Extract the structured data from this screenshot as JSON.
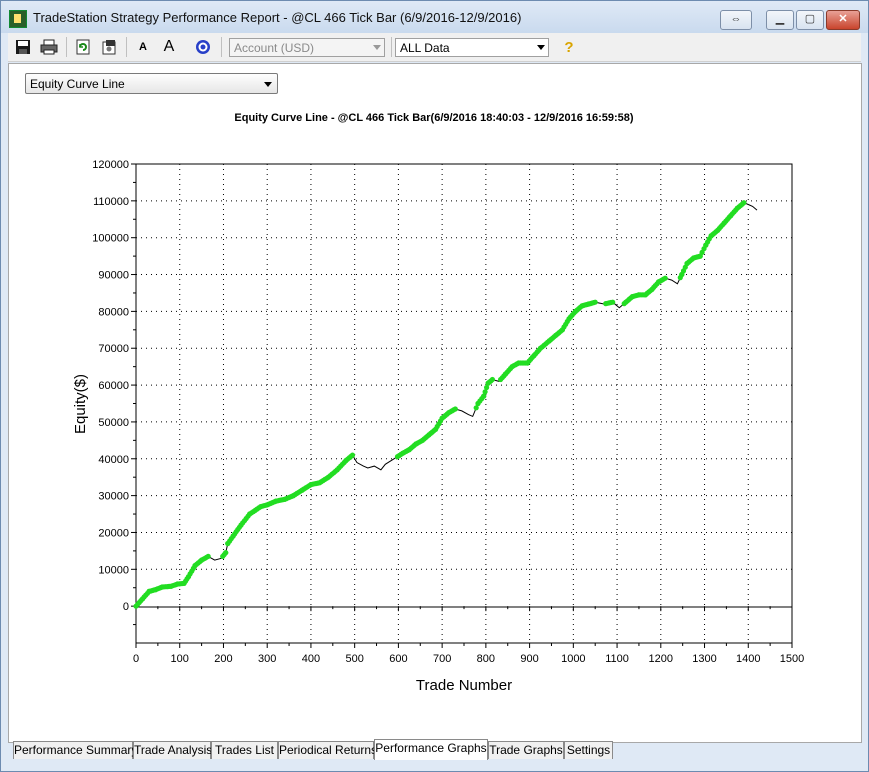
{
  "window": {
    "title": "TradeStation Strategy Performance Report - @CL 466 Tick Bar (6/9/2016-12/9/2016)",
    "controls": {
      "restore_arrows": "⇔",
      "minimize": "▁",
      "maximize": "▢",
      "close": "✕"
    }
  },
  "toolbar": {
    "icons": [
      "save-icon",
      "print-icon",
      "refresh-icon",
      "settings-icon",
      "font-decrease-icon",
      "font-increase-icon",
      "target-icon",
      "help-icon"
    ],
    "account_combo": "Account (USD)",
    "data_combo": "ALL Data",
    "font_small": "A",
    "font_big": "A",
    "help": "?"
  },
  "view_select": "Equity Curve Line",
  "chart": {
    "title": "Equity Curve Line - @CL 466 Tick Bar(6/9/2016 18:40:03 - 12/9/2016 16:59:58)",
    "xlabel": "Trade Number",
    "ylabel": "Equity($)"
  },
  "chart_data": {
    "type": "line",
    "title": "Equity Curve Line - @CL 466 Tick Bar(6/9/2016 18:40:03 - 12/9/2016 16:59:58)",
    "xlabel": "Trade Number",
    "ylabel": "Equity($)",
    "xlim": [
      0,
      1500
    ],
    "ylim": [
      -10000,
      120000
    ],
    "x_ticks": [
      "0",
      "100",
      "200",
      "300",
      "400",
      "500",
      "600",
      "700",
      "800",
      "900",
      "1000",
      "1100",
      "1200",
      "1300",
      "1400",
      "1500"
    ],
    "y_ticks": [
      "0",
      "10000",
      "20000",
      "30000",
      "40000",
      "50000",
      "60000",
      "70000",
      "80000",
      "90000",
      "100000",
      "110000",
      "120000"
    ],
    "grid": true,
    "line_color": "#000000",
    "highlight_color": "#22dd22",
    "series": [
      {
        "points": [
          [
            0,
            0
          ],
          [
            15,
            2000
          ],
          [
            30,
            4000
          ],
          [
            45,
            4500
          ],
          [
            60,
            5200
          ],
          [
            80,
            5400
          ],
          [
            95,
            6000
          ],
          [
            110,
            6200
          ],
          [
            120,
            8000
          ],
          [
            135,
            11000
          ],
          [
            150,
            12500
          ],
          [
            165,
            13500
          ],
          [
            180,
            12500
          ],
          [
            195,
            13000
          ],
          [
            205,
            14500
          ],
          [
            210,
            17000
          ],
          [
            222,
            19000
          ],
          [
            240,
            22000
          ],
          [
            260,
            25000
          ],
          [
            285,
            27000
          ],
          [
            300,
            27500
          ],
          [
            320,
            28500
          ],
          [
            340,
            29000
          ],
          [
            360,
            30000
          ],
          [
            380,
            31500
          ],
          [
            400,
            33000
          ],
          [
            420,
            33500
          ],
          [
            440,
            35000
          ],
          [
            460,
            37000
          ],
          [
            480,
            39500
          ],
          [
            495,
            41000
          ],
          [
            505,
            39000
          ],
          [
            520,
            38000
          ],
          [
            530,
            37500
          ],
          [
            545,
            38000
          ],
          [
            560,
            37000
          ],
          [
            570,
            38500
          ],
          [
            590,
            40000
          ],
          [
            610,
            41500
          ],
          [
            625,
            42500
          ],
          [
            640,
            44000
          ],
          [
            655,
            45000
          ],
          [
            670,
            46500
          ],
          [
            685,
            48000
          ],
          [
            700,
            51000
          ],
          [
            715,
            52500
          ],
          [
            730,
            53500
          ],
          [
            745,
            53000
          ],
          [
            760,
            52000
          ],
          [
            770,
            51500
          ],
          [
            782,
            55000
          ],
          [
            795,
            57000
          ],
          [
            805,
            60500
          ],
          [
            815,
            61500
          ],
          [
            830,
            61000
          ],
          [
            845,
            63000
          ],
          [
            860,
            65000
          ],
          [
            875,
            66000
          ],
          [
            895,
            66000
          ],
          [
            910,
            68000
          ],
          [
            925,
            70000
          ],
          [
            945,
            72000
          ],
          [
            960,
            73500
          ],
          [
            975,
            75000
          ],
          [
            990,
            78000
          ],
          [
            1005,
            80000
          ],
          [
            1020,
            81500
          ],
          [
            1035,
            82000
          ],
          [
            1050,
            82500
          ],
          [
            1070,
            82000
          ],
          [
            1090,
            82500
          ],
          [
            1105,
            81000
          ],
          [
            1120,
            82500
          ],
          [
            1135,
            84000
          ],
          [
            1150,
            84500
          ],
          [
            1165,
            84500
          ],
          [
            1180,
            86000
          ],
          [
            1195,
            88000
          ],
          [
            1210,
            89000
          ],
          [
            1225,
            88500
          ],
          [
            1238,
            87500
          ],
          [
            1248,
            90000
          ],
          [
            1260,
            93000
          ],
          [
            1275,
            94500
          ],
          [
            1290,
            95000
          ],
          [
            1303,
            98000
          ],
          [
            1315,
            100500
          ],
          [
            1330,
            102000
          ],
          [
            1345,
            104000
          ],
          [
            1360,
            106000
          ],
          [
            1375,
            108000
          ],
          [
            1390,
            109500
          ],
          [
            1400,
            109000
          ],
          [
            1410,
            108500
          ],
          [
            1420,
            107500
          ]
        ]
      }
    ]
  },
  "tabs": [
    "Performance Summary",
    "Trade Analysis",
    "Trades List",
    "Periodical Returns",
    "Performance Graphs",
    "Trade Graphs",
    "Settings"
  ],
  "active_tab": "Performance Graphs"
}
